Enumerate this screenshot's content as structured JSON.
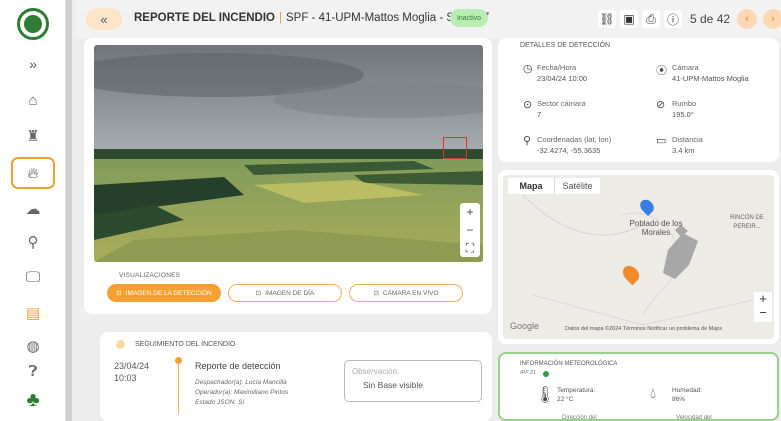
{
  "header": {
    "title_main": "REPORTE DEL INCENDIO",
    "title_sep": "|",
    "title_sub": "SPF - 41-UPM-Mattos Moglia - Sector 7",
    "status": "Inactivo",
    "counter": "5 de 42"
  },
  "nav": {
    "collapse": "»",
    "back": "«",
    "prev": "‹",
    "next": "›"
  },
  "visualizations": {
    "label": "VISUALIZACIONES",
    "buttons": [
      "IMAGEN DE LA DETECCIÓN",
      "IMAGEN DE DÍA",
      "CÁMARA EN VIVO"
    ]
  },
  "detection": {
    "title": "DETALLES DE DETECCIÓN",
    "fecha_label": "Fecha/Hora",
    "fecha_value": "23/04/24 10:00",
    "camara_label": "Cámara",
    "camara_value": "41-UPM-Mattos Moglia",
    "sector_label": "Sector cámara",
    "sector_value": "7",
    "rumbo_label": "Rumbo",
    "rumbo_value": "195.0°",
    "coord_label": "Coordenadas (lat, lon)",
    "coord_value": "-32.4274, -55.3635",
    "dist_label": "Distancia",
    "dist_value": "3.4 km"
  },
  "map": {
    "tab_map": "Mapa",
    "tab_sat": "Satélite",
    "place1": "Poblado de los Morales",
    "place2": "RINCÓN DE PEREIR...",
    "google": "Google",
    "footer": "Datos del mapa ©2024   Términos   Notificar un problema de Maps",
    "zoom_in": "+",
    "zoom_out": "−"
  },
  "tracking": {
    "title": "SEGUIMIENTO DEL INCENDIO",
    "date": "23/04/24",
    "time": "10:03",
    "event": "Reporte de detección",
    "line1": "Despachador(a): Lucía Mancilla",
    "line2": "Operador(a): Maximiliano Pintos",
    "line3": "Estado JSON: Sí",
    "obs_label": "Observación:",
    "obs_value": "Sin Base visible"
  },
  "weather": {
    "title": "INFORMACIÓN METEOROLÓGICA",
    "source": "IPF 21",
    "temp_label": "Temperatura:",
    "temp_value": "22 °C",
    "hum_label": "Humedad:",
    "hum_value": "86%",
    "wind_dir": "Dirección del",
    "wind_speed": "Velocidad del"
  }
}
